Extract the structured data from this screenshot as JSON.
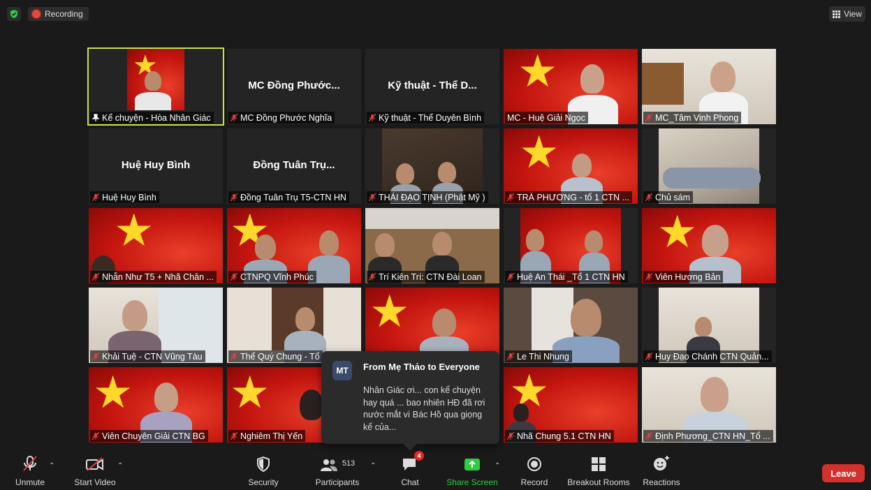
{
  "top": {
    "recording_label": "Recording",
    "view_label": "View"
  },
  "tiles": [
    {
      "name": "Kể chuyện - Hòa Nhân Giác",
      "pinned": true
    },
    {
      "name": "MC Đồng Phước Nghĩa",
      "big": "MC Đồng Phước..."
    },
    {
      "name": "Kỹ thuật - Thể Duyên Bình",
      "big": "Kỹ thuật - Thể D..."
    },
    {
      "name": "MC - Huệ Giải Ngọc"
    },
    {
      "name": "MC_Tâm Vinh Phong"
    },
    {
      "name": "Huệ Huy Bình",
      "big": "Huệ Huy Bình"
    },
    {
      "name": "Đồng Tuân Trụ T5-CTN HN",
      "big": "Đồng Tuân Trụ..."
    },
    {
      "name": "THÁI ĐẠO TỊNH (Phật Mỹ )"
    },
    {
      "name": "TRÀ PHƯƠNG - tổ 1 CTN ..."
    },
    {
      "name": "Chủ sám"
    },
    {
      "name": "Nhẫn Như T5 + Nhã Chân ..."
    },
    {
      "name": "CTNPQ Vĩnh Phúc"
    },
    {
      "name": "Trí Kiên Trí: CTN Đài Loan"
    },
    {
      "name": "Huệ An Thái _Tổ 1 CTN HN"
    },
    {
      "name": "Viên Hương Bản"
    },
    {
      "name": "Khải Tuệ - CTN Vũng Tàu"
    },
    {
      "name": "Thể Quý Chung - Tổ"
    },
    {
      "name": ""
    },
    {
      "name": "Le Thi Nhung"
    },
    {
      "name": "Huy Đạo Chánh CTN Quản..."
    },
    {
      "name": "Viên Chuyên Giải CTN BG"
    },
    {
      "name": "Nghiêm Thị Yến"
    },
    {
      "name": ""
    },
    {
      "name": "Nhã Chung 5.1 CTN HN"
    },
    {
      "name": "Định Phương_CTN HN_Tổ ..."
    }
  ],
  "chat_popup": {
    "avatar": "MT",
    "from": "From Mẹ Thảo to Everyone",
    "message": "Nhân Giác ơi... con kể chuyện hay quá ... bao nhiên HĐ đã rơi nước mắt vì Bác Hồ qua giọng kể của..."
  },
  "toolbar": {
    "unmute": "Unmute",
    "start_video": "Start Video",
    "security": "Security",
    "participants": "Participants",
    "participants_count": "513",
    "chat": "Chat",
    "chat_badge": "4",
    "share_screen": "Share Screen",
    "record": "Record",
    "breakout_rooms": "Breakout Rooms",
    "reactions": "Reactions",
    "leave": "Leave"
  },
  "colors": {
    "accent_green": "#2ecc40",
    "leave_red": "#d3312d",
    "active_speaker": "#c8e04a",
    "flag_red": "#c4150f",
    "flag_star": "#ffd82a"
  }
}
